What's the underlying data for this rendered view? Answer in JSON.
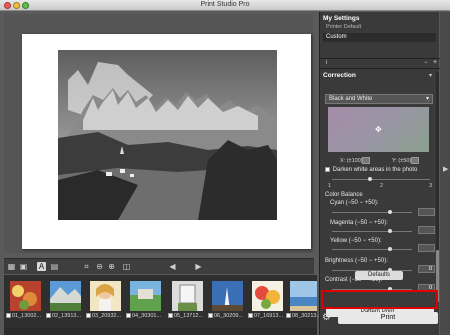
{
  "window": {
    "title": "Print Studio Pro"
  },
  "panel": {
    "settings_heading": "My Settings",
    "printer_default": "Printer Default",
    "custom_label": "Custom",
    "correction_heading": "Correction",
    "mode_dropdown": "Black and White",
    "x_label": "X: (±100)",
    "x_value": "0",
    "y_label": "Y: (±50)",
    "y_value": "0",
    "darken_label": "Darken white areas in the photo",
    "scale": [
      "1",
      "2",
      "3"
    ],
    "color_balance_heading": "Color Balance",
    "cyan_label": "Cyan (−50 − +50):",
    "magenta_label": "Magenta (−50 − +50):",
    "yellow_label": "Yellow (−50 − +50):",
    "brightness_label": "Brightness (−50 − +50):",
    "brightness_value": "0",
    "contrast_label": "Contrast (−50 − +50):",
    "contrast_value": "0",
    "defaults_button": "Defaults",
    "pattern_print_button": "Pattern Print...",
    "print_button": "Print"
  },
  "thumbnails": [
    {
      "label": "01_13002..."
    },
    {
      "label": "02_13913..."
    },
    {
      "label": "03_20932..."
    },
    {
      "label": "04_30301..."
    },
    {
      "label": "05_13712..."
    },
    {
      "label": "06_30209..."
    },
    {
      "label": "07_16913..."
    },
    {
      "label": "08_30213..."
    }
  ],
  "toolbar": {
    "icons": [
      "grid-view-icon",
      "single-view-icon",
      "text-icon",
      "zoom-page-icon",
      "crop-icon",
      "zoom-out-icon",
      "zoom-in-icon",
      "fit-icon",
      "prev-page-icon",
      "next-page-icon"
    ]
  },
  "colors": {
    "highlight": "#e00000",
    "panel_bg": "#3a3a3a"
  }
}
